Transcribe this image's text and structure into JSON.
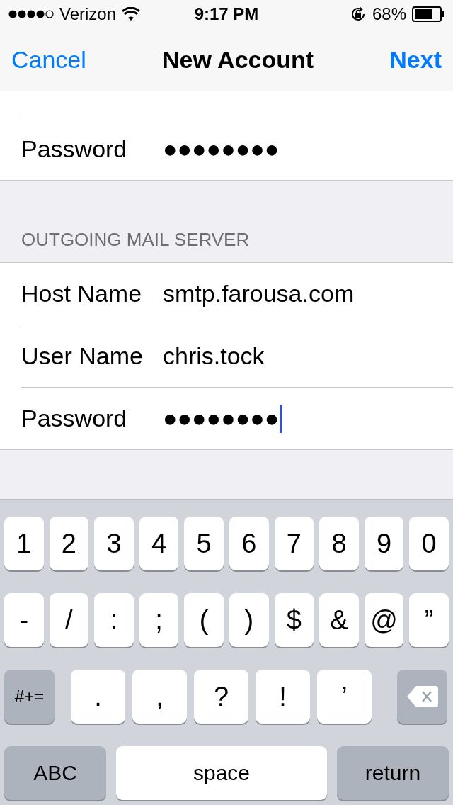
{
  "status_bar": {
    "carrier": "Verizon",
    "time": "9:17 PM",
    "battery": "68%"
  },
  "nav_bar": {
    "cancel": "Cancel",
    "title": "New Account",
    "next": "Next"
  },
  "sections": [
    {
      "rows": [
        {
          "label": "Password",
          "value": "●●●●●●●●",
          "focused": false
        }
      ]
    },
    {
      "header": "OUTGOING MAIL SERVER",
      "rows": [
        {
          "label": "Host Name",
          "value": "smtp.farousa.com",
          "focused": false
        },
        {
          "label": "User Name",
          "value": "chris.tock",
          "focused": false
        },
        {
          "label": "Password",
          "value": "●●●●●●●●",
          "focused": true
        }
      ]
    }
  ],
  "keyboard": {
    "rows": [
      {
        "keys": [
          {
            "kind": "char",
            "label": "1"
          },
          {
            "kind": "char",
            "label": "2"
          },
          {
            "kind": "char",
            "label": "3"
          },
          {
            "kind": "char",
            "label": "4"
          },
          {
            "kind": "char",
            "label": "5"
          },
          {
            "kind": "char",
            "label": "6"
          },
          {
            "kind": "char",
            "label": "7"
          },
          {
            "kind": "char",
            "label": "8"
          },
          {
            "kind": "char",
            "label": "9"
          },
          {
            "kind": "char",
            "label": "0"
          }
        ]
      },
      {
        "keys": [
          {
            "kind": "char",
            "label": "-"
          },
          {
            "kind": "char",
            "label": "/"
          },
          {
            "kind": "char",
            "label": ":"
          },
          {
            "kind": "char",
            "label": ";"
          },
          {
            "kind": "char",
            "label": "("
          },
          {
            "kind": "char",
            "label": ")"
          },
          {
            "kind": "char",
            "label": "$"
          },
          {
            "kind": "char",
            "label": "&"
          },
          {
            "kind": "char",
            "label": "@"
          },
          {
            "kind": "char",
            "label": "”"
          }
        ]
      },
      {
        "keys": [
          {
            "kind": "function",
            "label": "#+="
          },
          {
            "kind": "char",
            "label": "."
          },
          {
            "kind": "char",
            "label": ","
          },
          {
            "kind": "char",
            "label": "?"
          },
          {
            "kind": "char",
            "label": "!"
          },
          {
            "kind": "char",
            "label": "’"
          },
          {
            "kind": "delete"
          }
        ]
      },
      {
        "keys": [
          {
            "kind": "function",
            "label": "ABC"
          },
          {
            "kind": "space",
            "label": "space"
          },
          {
            "kind": "function",
            "label": "return"
          }
        ]
      }
    ]
  }
}
